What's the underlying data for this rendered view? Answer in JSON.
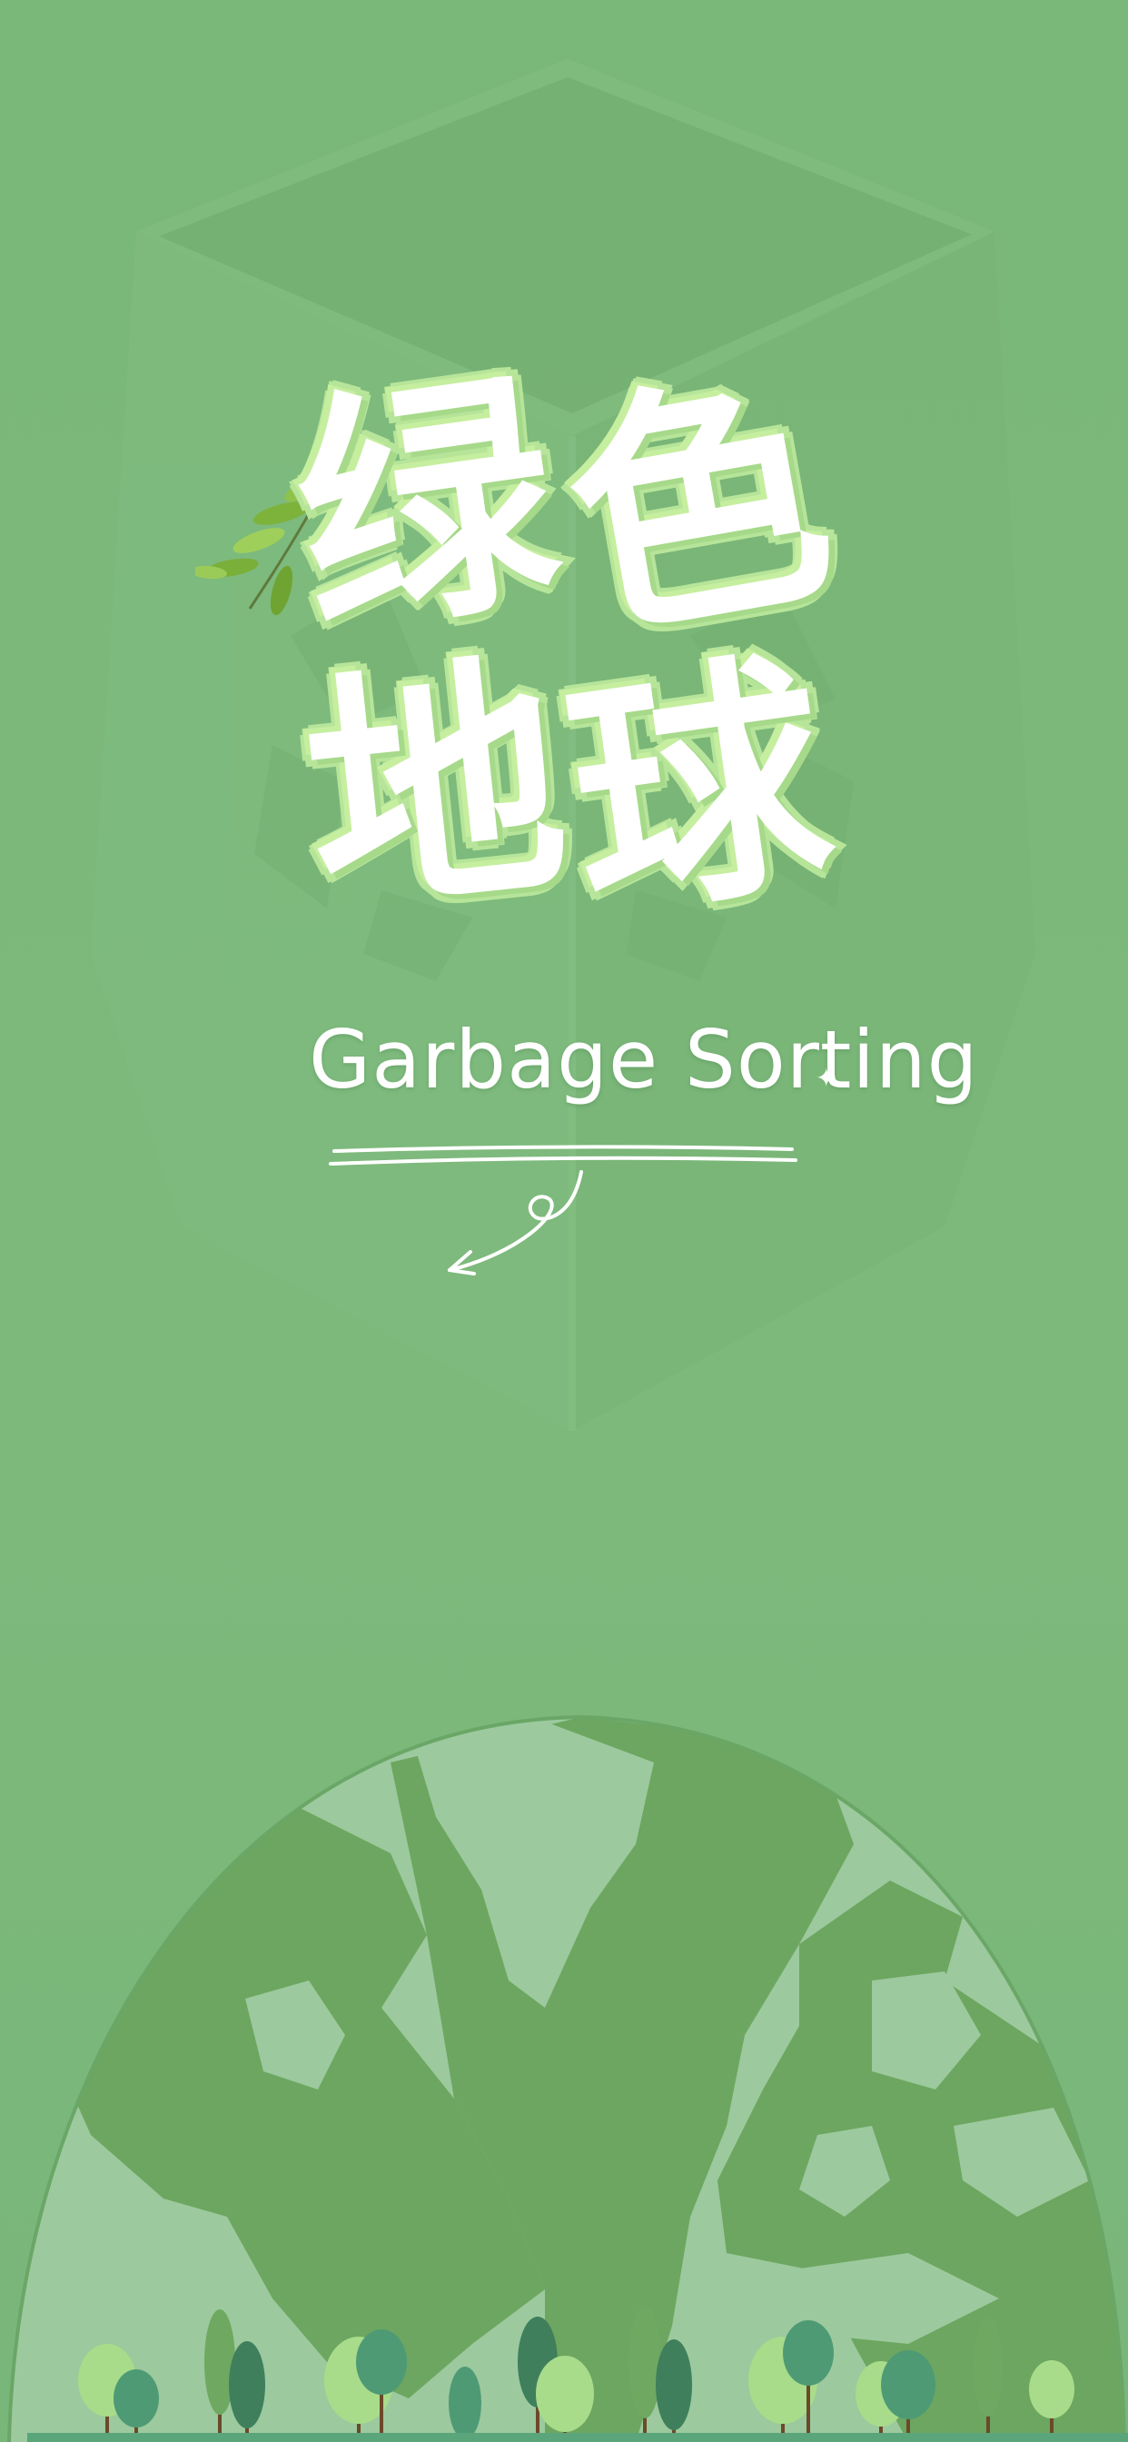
{
  "title": {
    "line1": [
      "绿",
      "色"
    ],
    "line2": [
      "地",
      "球"
    ]
  },
  "subtitle": "Garbage Sorting",
  "icons": {
    "leaf": "leaf-branch-icon",
    "sparkle": "sparkle-icon",
    "arrow": "curved-arrow-icon",
    "bin": "recycle-bin-icon",
    "globe": "globe-icon",
    "trees": "tree-icon"
  },
  "colors": {
    "background": "#7bb87b",
    "title_fill": "#ffffff",
    "title_stroke": "#b7e69a",
    "globe_land": "#6ca660",
    "globe_sea": "#9cc99d",
    "tree_light": "#a8dc8a",
    "tree_dark": "#3f7f5c",
    "tree_teal": "#4e9a75"
  }
}
